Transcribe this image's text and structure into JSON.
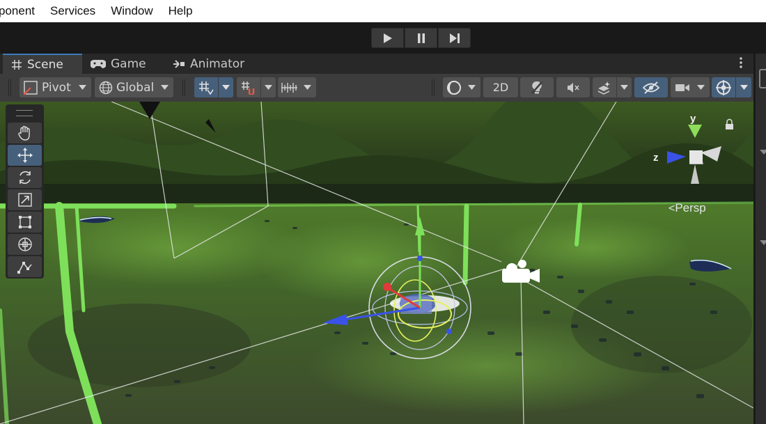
{
  "menubar": {
    "items": [
      "ponent",
      "Services",
      "Window",
      "Help"
    ]
  },
  "playbar": {
    "buttons": [
      "play-icon",
      "pause-icon",
      "step-icon"
    ]
  },
  "tabs": [
    {
      "label": "Scene",
      "icon": "hash-icon",
      "active": true
    },
    {
      "label": "Game",
      "icon": "gamepad-icon",
      "active": false
    },
    {
      "label": "Animator",
      "icon": "animator-icon",
      "active": false
    }
  ],
  "toolbar": {
    "pivot_label": "Pivot",
    "global_label": "Global",
    "twod_label": "2D"
  },
  "tools": [
    "hand-icon",
    "move-icon",
    "rotate-icon",
    "scale-icon",
    "rect-icon",
    "transform-icon",
    "custom-tool-icon"
  ],
  "gizmo": {
    "y_label": "y",
    "z_label": "z",
    "persp_label": "Persp"
  },
  "colors": {
    "accent": "#3a79bb",
    "active_button": "#46607c",
    "terrain": "#4a6b2a",
    "boundary": "#7ee05a"
  }
}
